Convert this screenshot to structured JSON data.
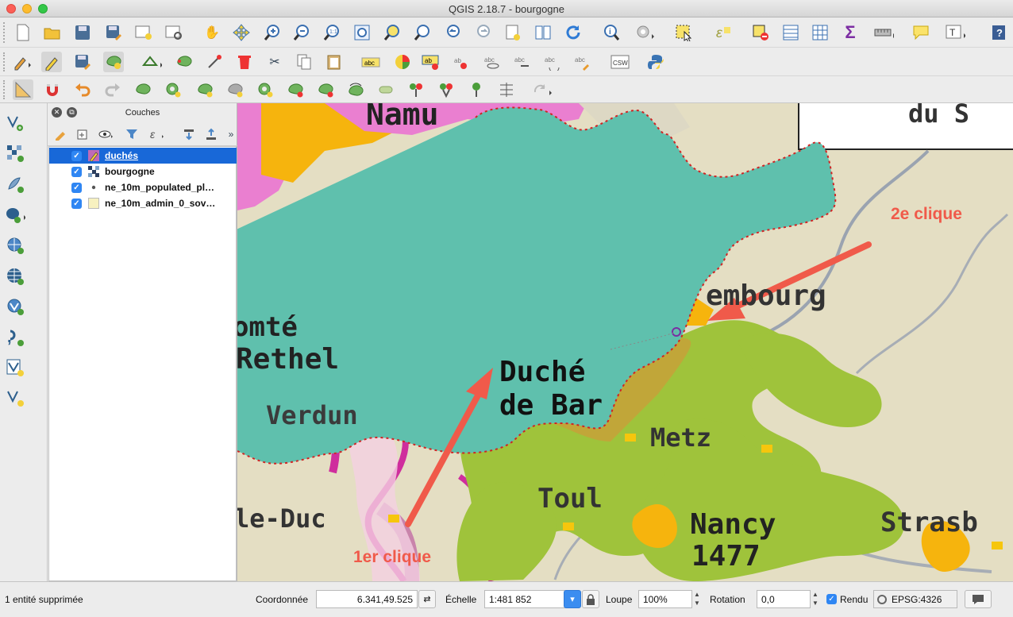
{
  "window": {
    "title": "QGIS 2.18.7 - bourgogne"
  },
  "layers_panel": {
    "title": "Couches",
    "layers": [
      {
        "name": "duchés",
        "checked": true,
        "selected": true,
        "icon": "polygon-edit-icon"
      },
      {
        "name": "bourgogne",
        "checked": true,
        "selected": false,
        "icon": "raster-icon"
      },
      {
        "name": "ne_10m_populated_pl…",
        "checked": true,
        "selected": false,
        "icon": "point-icon"
      },
      {
        "name": "ne_10m_admin_0_sov…",
        "checked": true,
        "selected": false,
        "icon": "polygon-icon"
      }
    ]
  },
  "map": {
    "labels": {
      "top_left": "Namu",
      "top_right": "du S",
      "comte": "omté",
      "rethel": "Rethel",
      "verdun": "Verdun",
      "duche1": "Duché",
      "duche2": "de Bar",
      "luxembourg": "embourg",
      "metz": "Metz",
      "toul": "Toul",
      "nancy": "Nancy",
      "nancy_year": "1477",
      "strasbourg": "Strasb",
      "bar_le_duc": "le-Duc"
    },
    "annotations": {
      "first_click": "1er clique",
      "second_click": "2e clique",
      "color": "#f05a4a"
    }
  },
  "statusbar": {
    "message": "1 entité supprimée",
    "coord_label": "Coordonnée",
    "coord_value": "6.341,49.525",
    "scale_label": "Échelle",
    "scale_value": "1:481 852",
    "zoom_label": "Loupe",
    "zoom_value": "100%",
    "rotation_label": "Rotation",
    "rotation_value": "0,0",
    "render_label": "Rendu",
    "crs": "EPSG:4326"
  }
}
